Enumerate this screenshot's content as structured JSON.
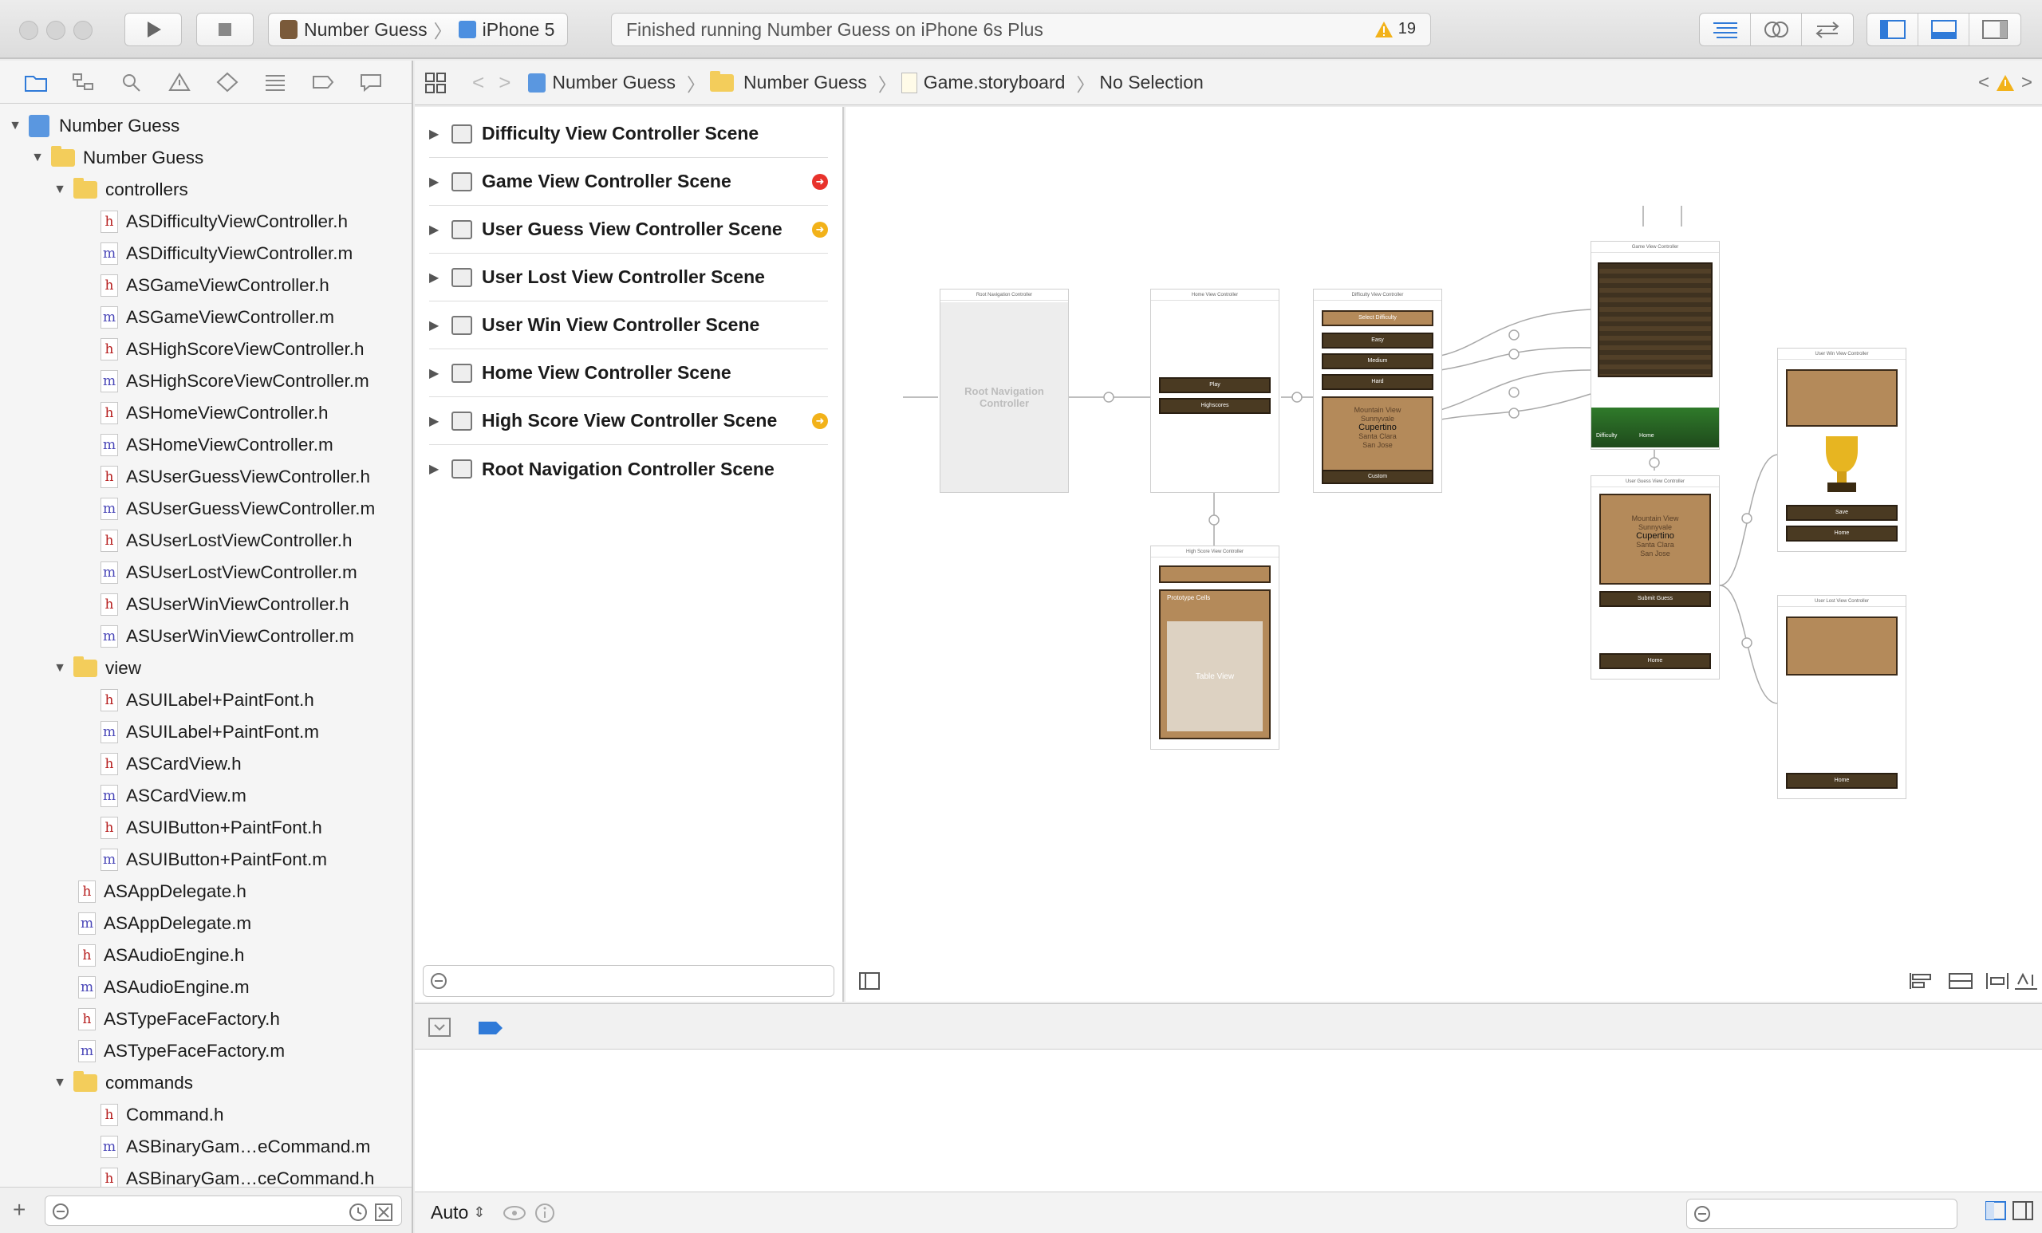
{
  "toolbar": {
    "scheme_target": "Number Guess",
    "scheme_device": "iPhone 5",
    "status": "Finished running Number Guess on iPhone 6s Plus",
    "warning_count": "19"
  },
  "jumpbar": {
    "crumbs": [
      "Number Guess",
      "Number Guess",
      "Game.storyboard",
      "No Selection"
    ]
  },
  "navigator": {
    "project": "Number Guess",
    "group": "Number Guess",
    "controllers_folder": "controllers",
    "controllers": [
      {
        "name": "ASDifficultyViewController.h",
        "kind": "h"
      },
      {
        "name": "ASDifficultyViewController.m",
        "kind": "m"
      },
      {
        "name": "ASGameViewController.h",
        "kind": "h"
      },
      {
        "name": "ASGameViewController.m",
        "kind": "m"
      },
      {
        "name": "ASHighScoreViewController.h",
        "kind": "h"
      },
      {
        "name": "ASHighScoreViewController.m",
        "kind": "m"
      },
      {
        "name": "ASHomeViewController.h",
        "kind": "h"
      },
      {
        "name": "ASHomeViewController.m",
        "kind": "m"
      },
      {
        "name": "ASUserGuessViewController.h",
        "kind": "h"
      },
      {
        "name": "ASUserGuessViewController.m",
        "kind": "m"
      },
      {
        "name": "ASUserLostViewController.h",
        "kind": "h"
      },
      {
        "name": "ASUserLostViewController.m",
        "kind": "m"
      },
      {
        "name": "ASUserWinViewController.h",
        "kind": "h"
      },
      {
        "name": "ASUserWinViewController.m",
        "kind": "m"
      }
    ],
    "view_folder": "view",
    "views": [
      {
        "name": "ASUILabel+PaintFont.h",
        "kind": "h"
      },
      {
        "name": "ASUILabel+PaintFont.m",
        "kind": "m"
      },
      {
        "name": "ASCardView.h",
        "kind": "h"
      },
      {
        "name": "ASCardView.m",
        "kind": "m"
      },
      {
        "name": "ASUIButton+PaintFont.h",
        "kind": "h"
      },
      {
        "name": "ASUIButton+PaintFont.m",
        "kind": "m"
      }
    ],
    "root_files": [
      {
        "name": "ASAppDelegate.h",
        "kind": "h"
      },
      {
        "name": "ASAppDelegate.m",
        "kind": "m"
      },
      {
        "name": "ASAudioEngine.h",
        "kind": "h"
      },
      {
        "name": "ASAudioEngine.m",
        "kind": "m"
      },
      {
        "name": "ASTypeFaceFactory.h",
        "kind": "h"
      },
      {
        "name": "ASTypeFaceFactory.m",
        "kind": "m"
      }
    ],
    "commands_folder": "commands",
    "commands": [
      {
        "name": "Command.h",
        "kind": "h"
      },
      {
        "name": "ASBinaryGam…eCommand.m",
        "kind": "m"
      },
      {
        "name": "ASBinaryGam…ceCommand.h",
        "kind": "h"
      }
    ]
  },
  "outline": {
    "scenes": [
      {
        "name": "Difficulty View Controller Scene",
        "badge": ""
      },
      {
        "name": "Game View Controller Scene",
        "badge": "error"
      },
      {
        "name": "User Guess View Controller Scene",
        "badge": "warning"
      },
      {
        "name": "User Lost View Controller Scene",
        "badge": ""
      },
      {
        "name": "User Win View Controller Scene",
        "badge": ""
      },
      {
        "name": "Home View Controller Scene",
        "badge": ""
      },
      {
        "name": "High Score View Controller Scene",
        "badge": "warning"
      },
      {
        "name": "Root Navigation Controller Scene",
        "badge": ""
      }
    ]
  },
  "storyboard": {
    "root_nav_title": "Root Navigation Controller",
    "root_nav_label": "Root Navigation Controller",
    "home_title": "Home View Controller",
    "difficulty_title": "Difficulty View Controller",
    "game_title": "Game View Controller",
    "user_win_title": "User Win View Controller",
    "user_guess_title": "User Guess View Controller",
    "user_lost_title": "User Lost View Controller",
    "high_score_title": "High Score View Controller",
    "home_buttons": [
      "Play",
      "Highscores"
    ],
    "difficulty_buttons": [
      "Select Difficulty",
      "Easy",
      "Medium",
      "Hard",
      "Custom"
    ],
    "picker_items": [
      "Mountain View",
      "Sunnyvale",
      "Cupertino",
      "Santa Clara",
      "San Jose"
    ],
    "prototype_cells": "Prototype Cells",
    "table_view": "Table View",
    "game_footer": [
      "Difficulty",
      "Home"
    ],
    "guess_buttons": [
      "Submit Guess",
      "Home"
    ],
    "win_buttons": [
      "Save",
      "Home"
    ],
    "lost_buttons": [
      "Home"
    ]
  },
  "debug": {
    "auto_label": "Auto"
  },
  "colors": {
    "error": "#e8322b",
    "warning": "#f2b21a",
    "accent": "#2f7ad8"
  }
}
